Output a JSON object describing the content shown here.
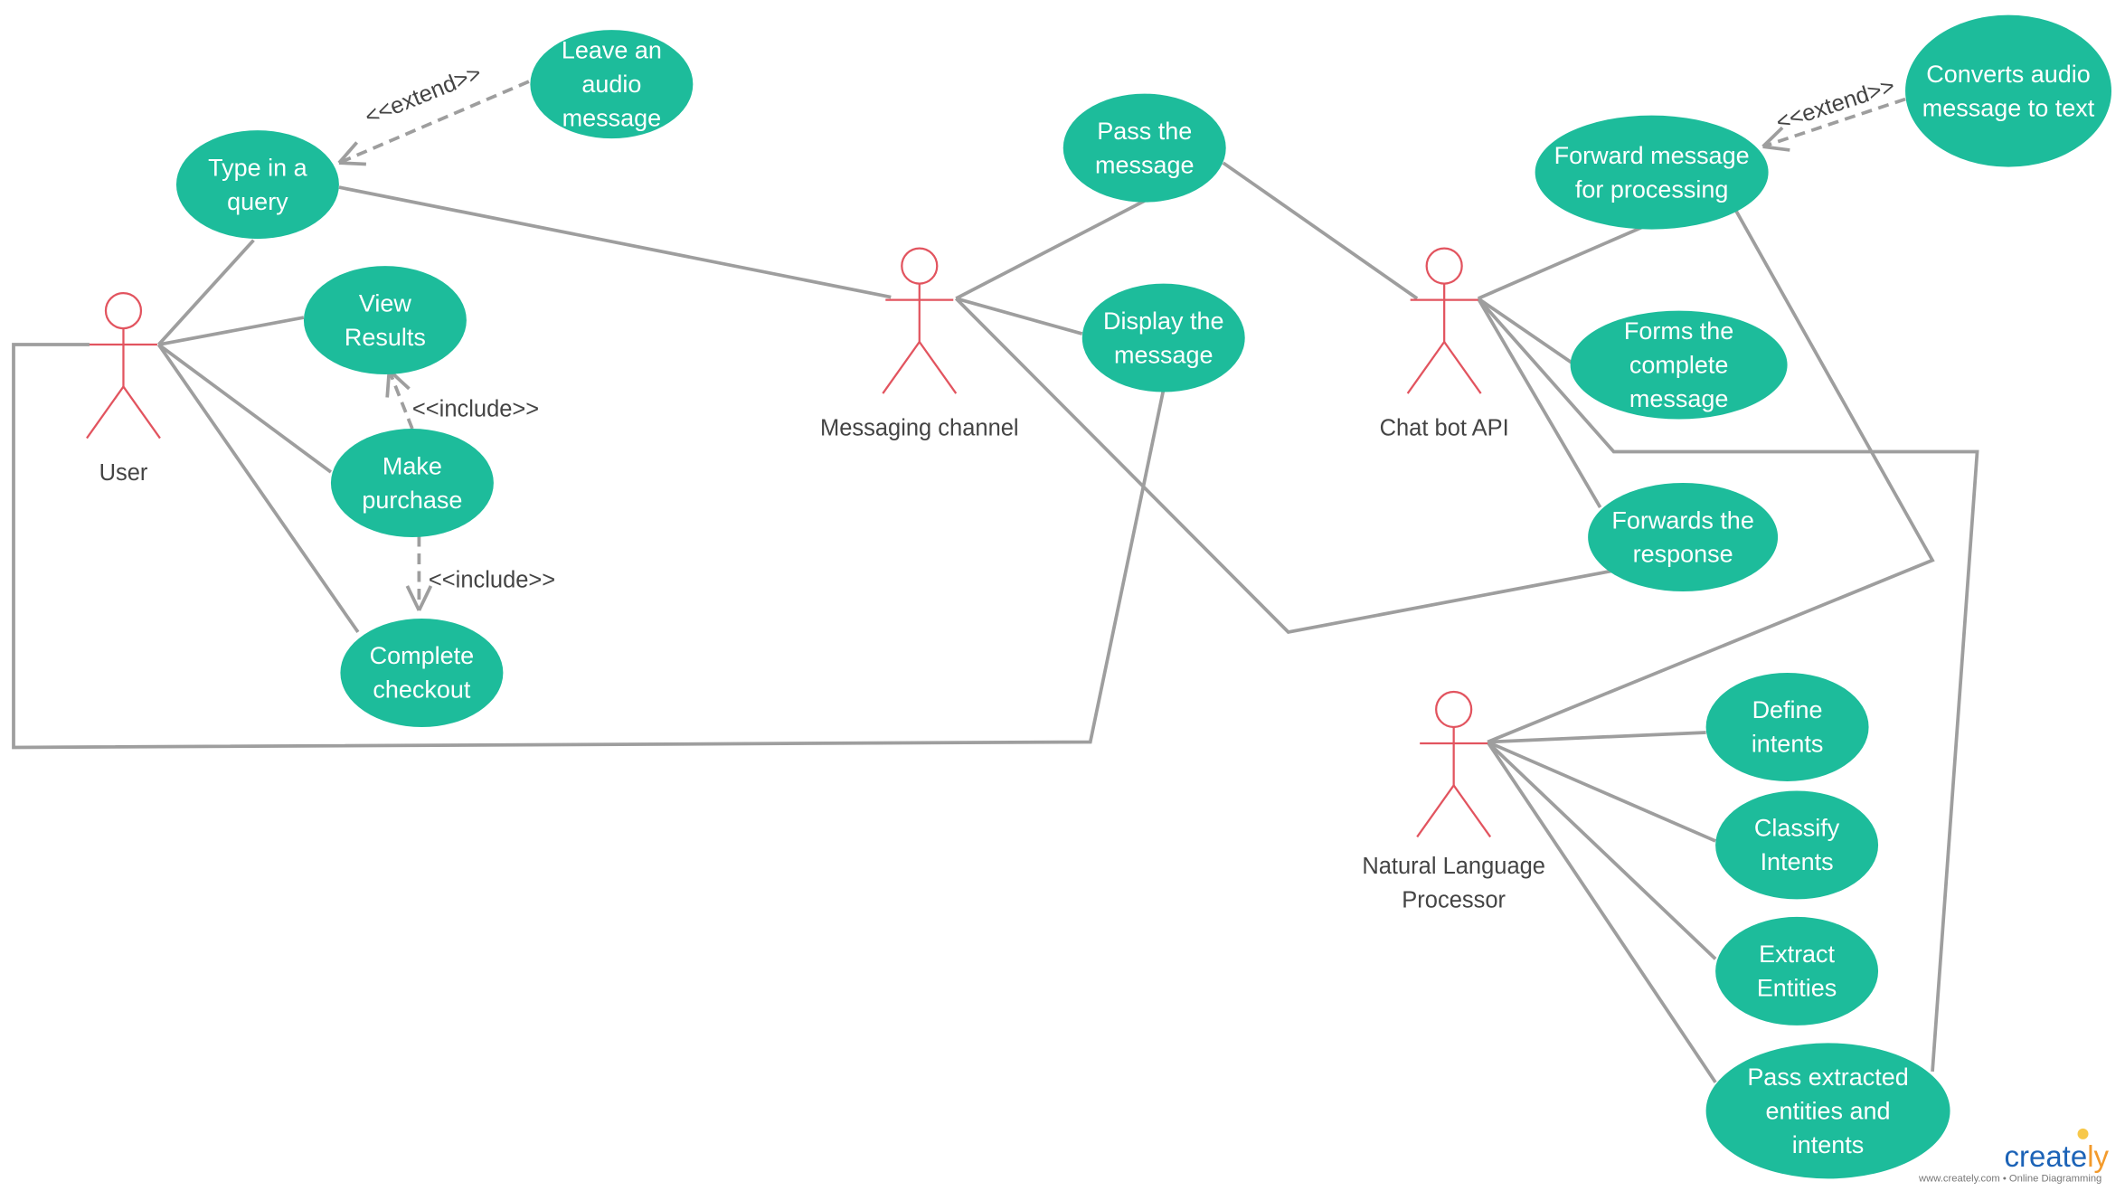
{
  "colors": {
    "usecase": "#1dbc9b",
    "actor": "#e2545f",
    "line": "#9e9e9e",
    "text": "#444444"
  },
  "actors": [
    {
      "id": "user",
      "lines": [
        "User"
      ]
    },
    {
      "id": "messaging",
      "lines": [
        "Messaging channel"
      ]
    },
    {
      "id": "chatbot",
      "lines": [
        "Chat bot API"
      ]
    },
    {
      "id": "nlp",
      "lines": [
        "Natural Language",
        "Processor"
      ]
    }
  ],
  "usecases": [
    {
      "id": "leave-audio",
      "lines": [
        "Leave an",
        "audio",
        "message"
      ]
    },
    {
      "id": "type-query",
      "lines": [
        "Type in a",
        "query"
      ]
    },
    {
      "id": "view-results",
      "lines": [
        "View",
        "Results"
      ]
    },
    {
      "id": "make-purchase",
      "lines": [
        "Make",
        "purchase"
      ]
    },
    {
      "id": "complete-checkout",
      "lines": [
        "Complete",
        "checkout"
      ]
    },
    {
      "id": "pass-message",
      "lines": [
        "Pass the",
        "message"
      ]
    },
    {
      "id": "display-message",
      "lines": [
        "Display the",
        "message"
      ]
    },
    {
      "id": "forward-message",
      "lines": [
        "Forward message",
        "for processing"
      ]
    },
    {
      "id": "converts-audio",
      "lines": [
        "Converts audio",
        "message to text"
      ]
    },
    {
      "id": "forms-message",
      "lines": [
        "Forms the",
        "complete",
        "message"
      ]
    },
    {
      "id": "forwards-response",
      "lines": [
        "Forwards the",
        "response"
      ]
    },
    {
      "id": "define-intents",
      "lines": [
        "Define",
        "intents"
      ]
    },
    {
      "id": "classify-intents",
      "lines": [
        "Classify",
        "Intents"
      ]
    },
    {
      "id": "extract-entities",
      "lines": [
        "Extract",
        "Entities"
      ]
    },
    {
      "id": "pass-extracted",
      "lines": [
        "Pass extracted",
        "entities and",
        "intents"
      ]
    }
  ],
  "relations": {
    "extend": "<<extend>>",
    "include": "<<include>>"
  },
  "logo": {
    "brand": "creately",
    "tagline": "www.creately.com • Online Diagramming"
  }
}
